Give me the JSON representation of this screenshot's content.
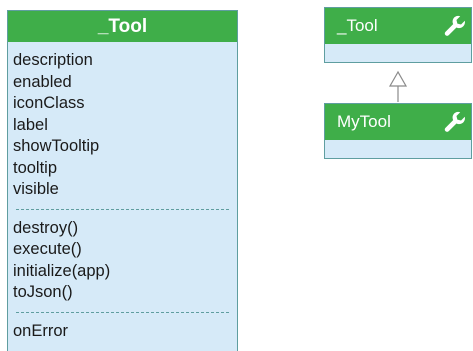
{
  "big_class": {
    "title": "_Tool",
    "properties": [
      "description",
      "enabled",
      "iconClass",
      "label",
      "showTooltip",
      "tooltip",
      "visible"
    ],
    "methods": [
      "destroy()",
      "execute()",
      "initialize(app)",
      "toJson()"
    ],
    "events": [
      "onError"
    ]
  },
  "parent_class": {
    "title": "_Tool",
    "icon": "wrench-icon"
  },
  "child_class": {
    "title": "MyTool",
    "icon": "wrench-icon"
  },
  "colors": {
    "header": "#3fae49",
    "body": "#d6eaf8",
    "border": "#5f9ea0"
  }
}
